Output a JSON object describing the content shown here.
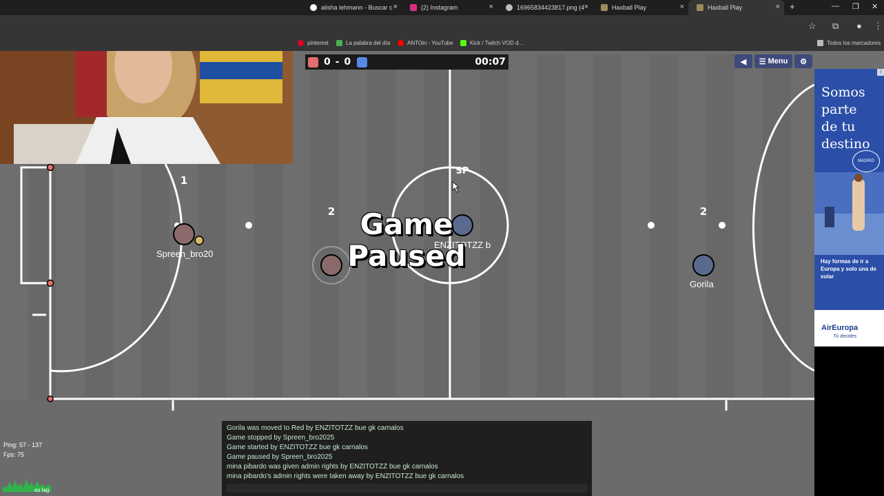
{
  "browser": {
    "tabs": [
      {
        "label": "alisha lehmann - Buscar c",
        "active": false
      },
      {
        "label": "(2) Instagram",
        "active": false
      },
      {
        "label": "16965834423817.png (4",
        "active": false
      },
      {
        "label": "Haxball Play",
        "active": false
      },
      {
        "label": "Haxball Play",
        "active": true
      }
    ],
    "new_tab": "+",
    "bookmarks": [
      {
        "label": "pinterest",
        "color": "#e60023"
      },
      {
        "label": "La palabra del día",
        "color": "#4caf50"
      },
      {
        "label": "ANTOin - YouTube",
        "color": "#ff0000"
      },
      {
        "label": "Kick / Twitch VOD d...",
        "color": "#53fc18"
      }
    ],
    "all_bookmarks": "Todos los marcadores"
  },
  "game": {
    "score_red": 0,
    "score_sep": "-",
    "score_blue": 0,
    "timer": "00:07",
    "menu_label": "Menu",
    "paused_line1": "Game",
    "paused_line2": "Paused",
    "players": [
      {
        "name": "Spreen_bro20",
        "number": "1",
        "team": "red"
      },
      {
        "name": "",
        "number": "2",
        "team": "red"
      },
      {
        "name": "ENZITOTZZ b",
        "number": "SP",
        "team": "blue"
      },
      {
        "name": "Gorila",
        "number": "2",
        "team": "blue"
      }
    ],
    "colors": {
      "red": "#e56e6e",
      "blue": "#5689e5",
      "pitch": "#6b6b6b",
      "line": "#ffffff"
    }
  },
  "chat": {
    "messages": [
      "Gorila was moved to Red by ENZITOTZZ bue gk carnalos",
      "Game stopped by Spreen_bro2025",
      "Game started by ENZITOTZZ bue gk carnalos",
      "Game paused by Spreen_bro2025",
      "mina pibardo was given admin rights by ENZITOTZZ bue gk carnalos",
      "mina pibardo's admin rights were taken away by ENZITOTZZ bue gk carnalos"
    ]
  },
  "stats": {
    "ping": "Ping: 57 - 137",
    "fps": "Fps: 75",
    "lag": "es lag"
  },
  "ad": {
    "title_lines": [
      "Somos",
      "parte",
      "de tu",
      "destino"
    ],
    "badge": "MADRID",
    "body": "Hay formas de ir a Europa y solo una de volar",
    "brand": "AirEuropa",
    "tagline": "Tú decides"
  }
}
